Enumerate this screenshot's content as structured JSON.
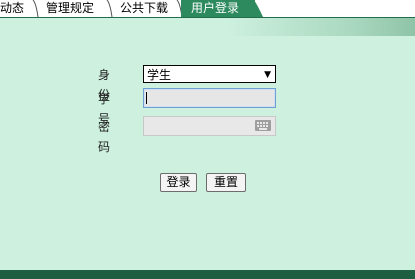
{
  "tabs": [
    {
      "label": "动态",
      "active": false
    },
    {
      "label": "管理规定",
      "active": false
    },
    {
      "label": "公共下载",
      "active": false
    },
    {
      "label": "用户登录",
      "active": true
    }
  ],
  "form": {
    "identity_label": "身份",
    "identity_value": "学生",
    "student_id_label": "学号",
    "student_id_value": "",
    "password_label": "密码",
    "password_value": ""
  },
  "buttons": {
    "login": "登录",
    "reset": "重置"
  },
  "colors": {
    "panel_bg": "#cdf0df",
    "active_tab": "#2d8a5f",
    "bottom_bar": "#1f5e41"
  },
  "icons": {
    "dropdown": "chevron-down-icon",
    "keyboard": "keyboard-icon"
  }
}
